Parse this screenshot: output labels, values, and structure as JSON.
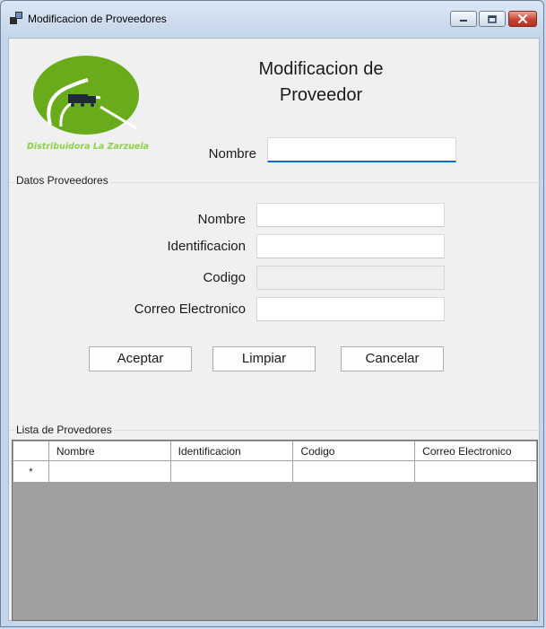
{
  "window": {
    "title": "Modificacion de Proveedores"
  },
  "header": {
    "heading_line1": "Modificacion de",
    "heading_line2": "Proveedor",
    "logo_text": "Distribuidora La Zarzuela",
    "search_label": "Nombre",
    "search_value": ""
  },
  "datos": {
    "caption": "Datos Proveedores",
    "fields": [
      {
        "label": "Nombre",
        "value": ""
      },
      {
        "label": "Identificacion",
        "value": ""
      },
      {
        "label": "Codigo",
        "value": ""
      },
      {
        "label": "Correo Electronico",
        "value": ""
      }
    ],
    "buttons": {
      "accept": "Aceptar",
      "clear": "Limpiar",
      "cancel": "Cancelar"
    }
  },
  "lista": {
    "caption": "Lista de Provedores",
    "columns": [
      "Nombre",
      "Identificacion",
      "Codigo",
      "Correo Electronico"
    ],
    "new_row_marker": "*"
  },
  "colors": {
    "logo_green": "#6aab1c",
    "logo_text": "#8fd14a",
    "grid_empty": "#a0a0a0",
    "focus_blue": "#0a6ad2"
  }
}
